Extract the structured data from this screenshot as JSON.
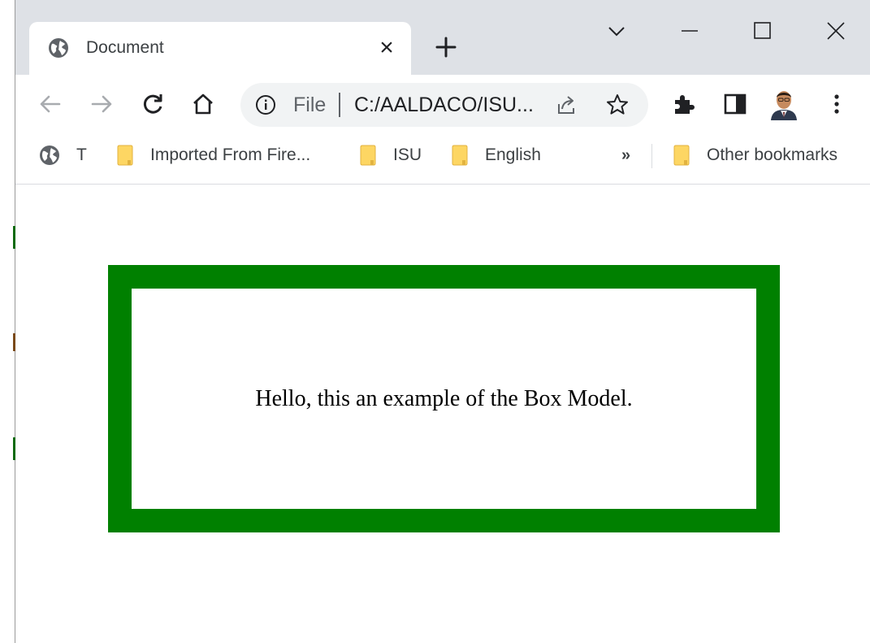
{
  "tab": {
    "title": "Document",
    "favicon_icon": "globe-icon",
    "close_label": "×"
  },
  "toolbar": {
    "back_icon": "back-arrow-icon",
    "forward_icon": "forward-arrow-icon",
    "reload_icon": "reload-icon",
    "home_icon": "home-icon",
    "address": {
      "scheme_label": "File",
      "url": "C:/AALDACO/ISU..."
    },
    "extensions_icon": "puzzle-icon",
    "side_panel_icon": "side-panel-icon",
    "menu_icon": "kebab-menu-icon"
  },
  "bookmarks": {
    "items": [
      {
        "label": "T",
        "icon": "globe-icon"
      },
      {
        "label": "Imported From Fire...",
        "icon": "folder-icon"
      },
      {
        "label": "ISU",
        "icon": "folder-icon"
      },
      {
        "label": "English",
        "icon": "folder-icon"
      }
    ],
    "overflow_label": "»",
    "other_label": "Other bookmarks"
  },
  "page": {
    "text": "Hello, this an example of the Box Model.",
    "border_color": "#008000"
  },
  "colors": {
    "tabstrip": "#dee1e6",
    "omnibox": "#f1f3f4",
    "folder": "#fdd663"
  }
}
